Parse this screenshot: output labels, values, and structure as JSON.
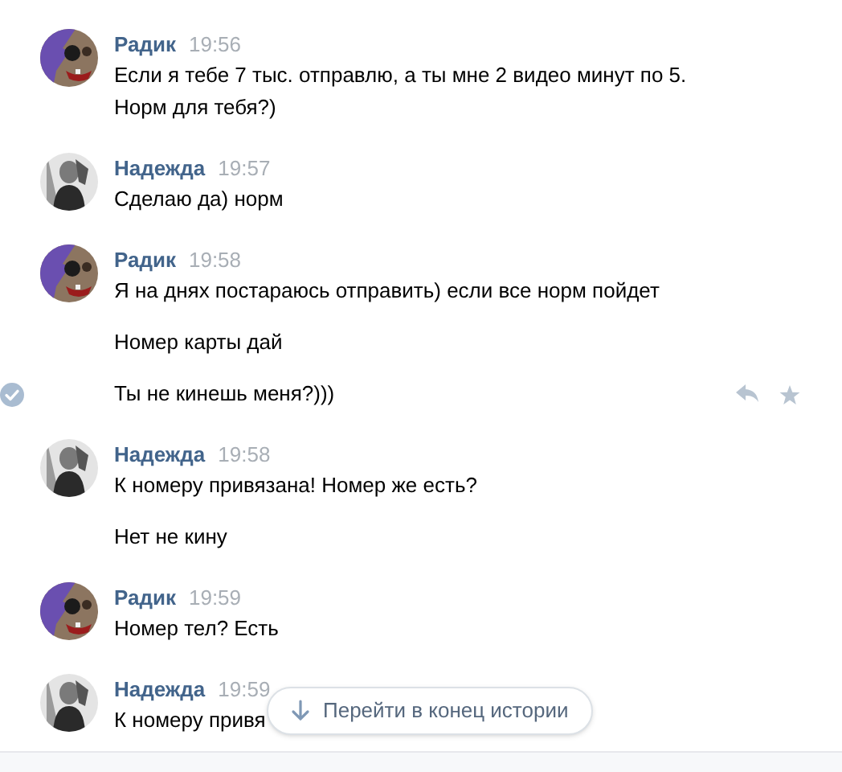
{
  "groups": [
    {
      "author": "Радик",
      "time": "19:56",
      "avatar": {
        "kind": "picture"
      },
      "messages": [
        {
          "text": "Если я тебе 7 тыс. отправлю, а ты мне 2 видео минут по 5. Норм для тебя?)",
          "hovered": false
        }
      ]
    },
    {
      "author": "Надежда",
      "time": "19:57",
      "avatar": {
        "kind": "picture"
      },
      "messages": [
        {
          "text": "Сделаю да) норм",
          "hovered": false
        }
      ]
    },
    {
      "author": "Радик",
      "time": "19:58",
      "avatar": {
        "kind": "picture"
      },
      "messages": [
        {
          "text": "Я на днях постараюсь отправить) если все норм пойдет",
          "hovered": false
        },
        {
          "text": "Номер карты дай",
          "hovered": false
        },
        {
          "text": "Ты не кинешь меня?)))",
          "hovered": true
        }
      ]
    },
    {
      "author": "Надежда",
      "time": "19:58",
      "avatar": {
        "kind": "picture"
      },
      "messages": [
        {
          "text": "К номеру привязана! Номер же есть?",
          "hovered": false
        },
        {
          "text": "Нет не кину",
          "hovered": false
        }
      ]
    },
    {
      "author": "Радик",
      "time": "19:59",
      "avatar": {
        "kind": "picture"
      },
      "messages": [
        {
          "text": "Номер тел? Есть",
          "hovered": false
        }
      ]
    },
    {
      "author": "Надежда",
      "time": "19:59",
      "avatar": {
        "kind": "picture"
      },
      "messages": [
        {
          "text": "К номеру привя",
          "hovered": false
        }
      ]
    }
  ],
  "scroll_button": {
    "label": "Перейти в конец истории"
  }
}
